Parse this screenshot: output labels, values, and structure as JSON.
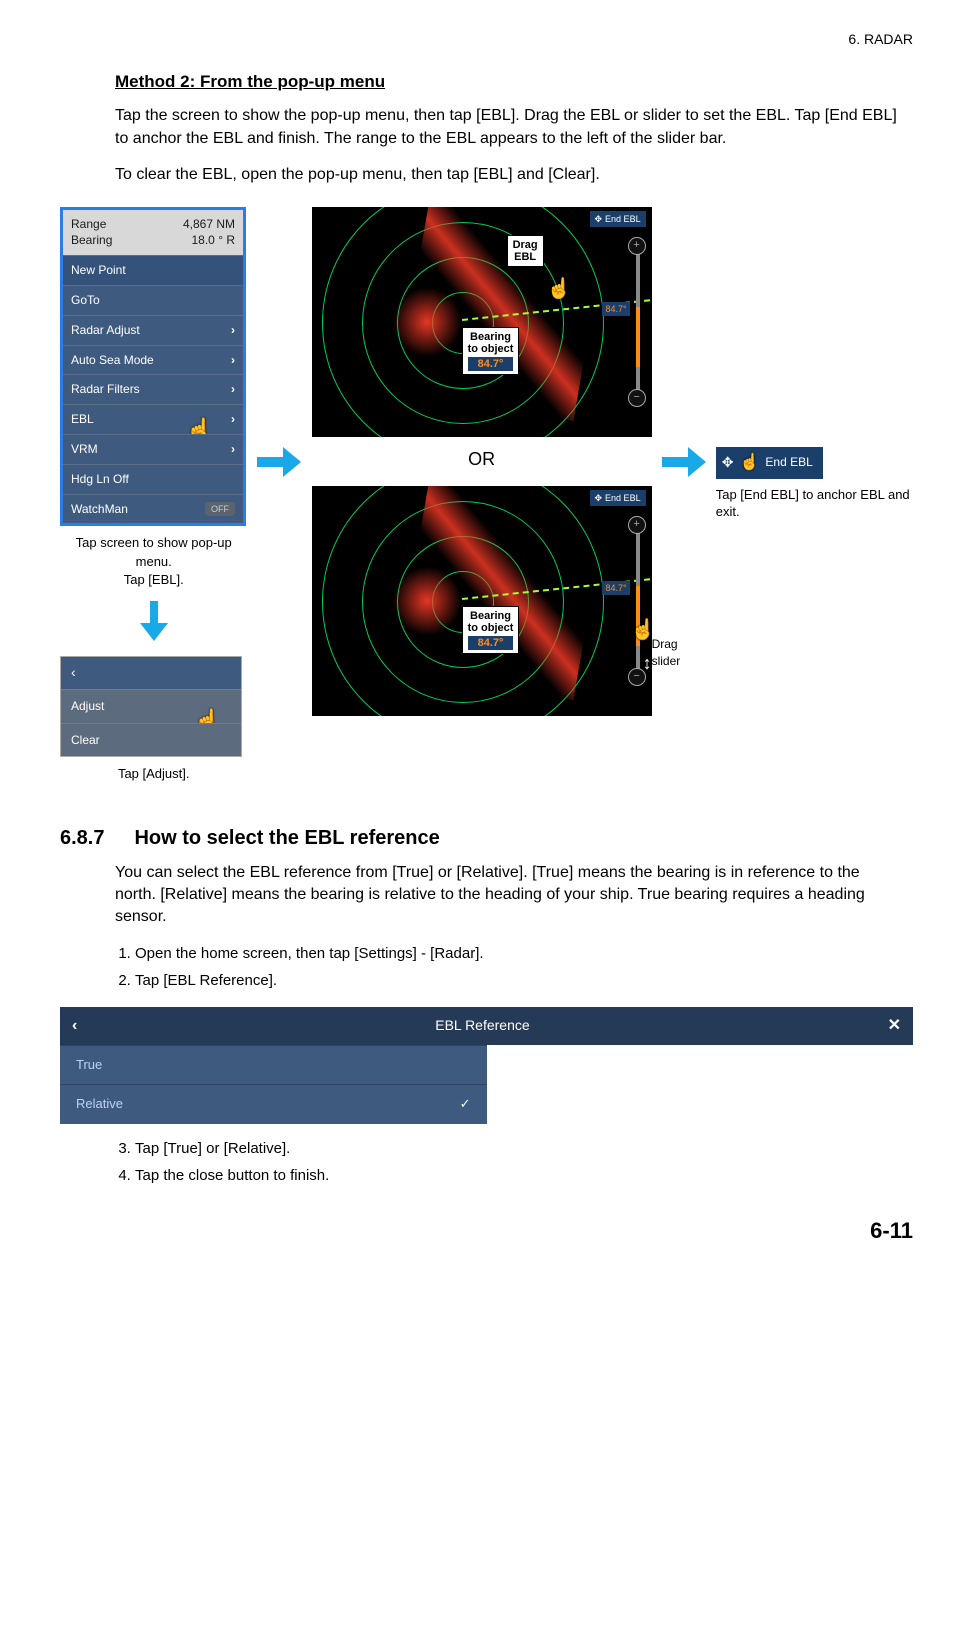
{
  "header": {
    "chapter": "6.  RADAR"
  },
  "method2": {
    "title": "Method 2: From the pop-up menu",
    "para1": "Tap the screen to show the pop-up menu, then tap [EBL]. Drag the EBL or slider to set the EBL. Tap [End EBL] to anchor the EBL and finish. The range to the EBL appears to the left of the slider bar.",
    "para2": "To clear the EBL, open the pop-up menu, then tap [EBL] and [Clear]."
  },
  "popup": {
    "range_label": "Range",
    "range_value": "4,867 NM",
    "bearing_label": "Bearing",
    "bearing_value": "18.0 ° R",
    "items": [
      {
        "label": "New Point",
        "chev": false
      },
      {
        "label": "GoTo",
        "chev": false
      },
      {
        "label": "Radar Adjust",
        "chev": true
      },
      {
        "label": "Auto Sea Mode",
        "chev": true
      },
      {
        "label": "Radar Filters",
        "chev": true
      },
      {
        "label": "EBL",
        "chev": true
      },
      {
        "label": "VRM",
        "chev": true
      },
      {
        "label": "Hdg Ln Off",
        "chev": false
      },
      {
        "label": "WatchMan",
        "chev": false,
        "badge": "OFF"
      }
    ],
    "caption": "Tap screen to show pop-up menu.\nTap [EBL]."
  },
  "ebl_submenu": {
    "back": "‹",
    "items": [
      "Adjust",
      "Clear"
    ],
    "caption": "Tap [Adjust]."
  },
  "radar": {
    "drag_ebl": "Drag\nEBL",
    "bearing_label": "Bearing\nto object",
    "bearing_value": "84.7°",
    "end_ebl": "End EBL",
    "drag_slider": "Drag\nslider",
    "or": "OR"
  },
  "end_step": {
    "label": "End EBL",
    "caption": "Tap [End EBL] to anchor EBL and exit."
  },
  "section687": {
    "num": "6.8.7",
    "title": "How to select the EBL reference",
    "para1": "You can select the EBL reference from [True] or [Relative]. [True] means the bearing is in reference to the north. [Relative] means the bearing is relative to the heading of your ship. True bearing requires a heading sensor.",
    "steps": [
      "Open the home screen, then tap [Settings] - [Radar].",
      "Tap [EBL Reference].",
      "Tap [True] or [Relative].",
      "Tap the close button to finish."
    ]
  },
  "ref_panel": {
    "title": "EBL Reference",
    "options": [
      "True",
      "Relative"
    ],
    "selected": "Relative"
  },
  "page_num": "6-11"
}
